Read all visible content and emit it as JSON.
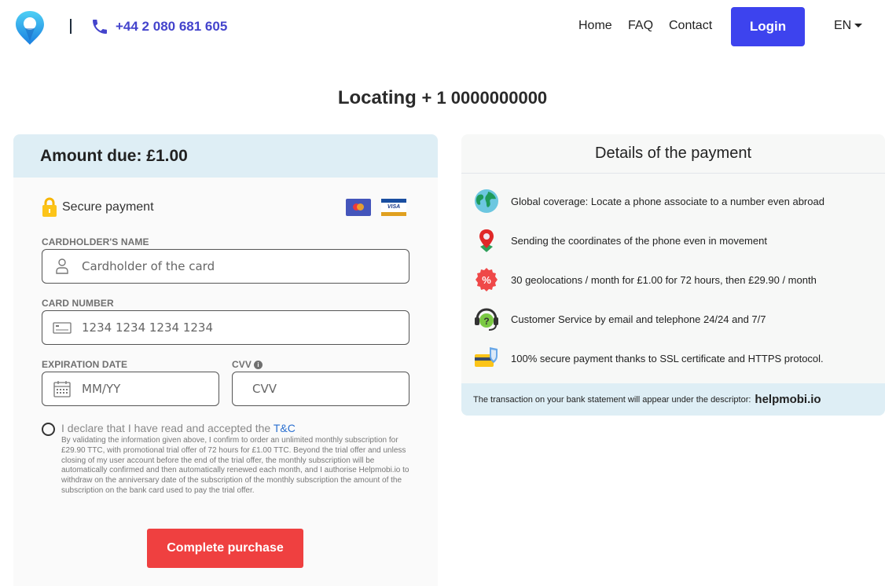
{
  "header": {
    "phone": "+44 2 080 681 605",
    "nav": [
      {
        "label": "Home"
      },
      {
        "label": "FAQ"
      },
      {
        "label": "Contact"
      }
    ],
    "login_label": "Login",
    "language": "EN",
    "accent_color": "#3d43ee"
  },
  "page": {
    "title_prefix": "Locating",
    "title_number": "+ 1 0000000000"
  },
  "payment_form": {
    "amount_due": "Amount due: £1.00",
    "secure_label": "Secure payment",
    "card_brands": [
      "mastercard",
      "visa"
    ],
    "cardholder_label": "CARDHOLDER'S NAME",
    "cardholder_placeholder": "Cardholder of the card",
    "card_number_label": "CARD NUMBER",
    "card_number_placeholder": "1234 1234 1234 1234",
    "expiration_label": "EXPIRATION DATE",
    "expiration_placeholder": "MM/YY",
    "cvv_label": "CVV",
    "cvv_placeholder": "CVV",
    "consent_text": "I declare that I have read and accepted the",
    "consent_link": "T&C",
    "legal_text": "By validating the information given above, I confirm to order an unlimited monthly subscription for £29.90 TTC, with promotional trial offer of 72 hours for £1.00 TTC. Beyond the trial offer and unless closing of my user account before the end of the trial offer, the monthly subscription will be automatically confirmed and then automatically renewed each month, and I authorise Helpmobi.io to withdraw on the anniversary date of the subscription of the monthly subscription the amount of the subscription on the bank card used to pay the trial offer.",
    "submit_label": "Complete purchase",
    "submit_color": "#ef4040"
  },
  "details": {
    "title": "Details of the payment",
    "features": [
      {
        "icon": "globe-icon",
        "text": "Global coverage: Locate a phone associate to a number even abroad"
      },
      {
        "icon": "map-pin-icon",
        "text": "Sending the coordinates of the phone even in movement"
      },
      {
        "icon": "discount-badge-icon",
        "text": "30 geolocations / month for £1.00 for 72 hours, then £29.90 / month"
      },
      {
        "icon": "headset-support-icon",
        "text": "Customer Service by email and telephone 24/24 and 7/7"
      },
      {
        "icon": "secure-card-icon",
        "text": "100% secure payment thanks to SSL certificate and HTTPS protocol."
      }
    ],
    "descriptor_text": "The transaction on your bank statement will appear under the descriptor:",
    "descriptor_value": "helpmobi.io"
  }
}
